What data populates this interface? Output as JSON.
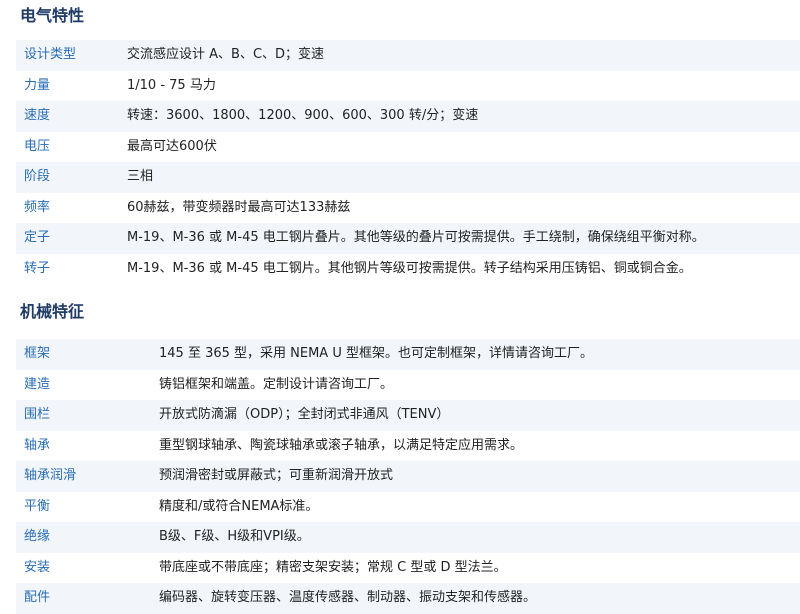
{
  "electrical": {
    "title": "电气特性",
    "rows": [
      {
        "label": "设计类型",
        "value": "交流感应设计 A、B、C、D；变速"
      },
      {
        "label": "力量",
        "value": "1/10 - 75 马力"
      },
      {
        "label": "速度",
        "value": "转速：3600、1800、1200、900、600、300 转/分；变速"
      },
      {
        "label": "电压",
        "value": "最高可达600伏"
      },
      {
        "label": "阶段",
        "value": "三相"
      },
      {
        "label": "频率",
        "value": "60赫兹，带变频器时最高可达133赫兹"
      },
      {
        "label": "定子",
        "value": "M-19、M-36 或 M-45 电工钢片叠片。其他等级的叠片可按需提供。手工绕制，确保绕组平衡对称。"
      },
      {
        "label": "转子",
        "value": "M-19、M-36 或 M-45 电工钢片。其他钢片等级可按需提供。转子结构采用压铸铝、铜或铜合金。"
      }
    ]
  },
  "mechanical": {
    "title": "机械特征",
    "rows": [
      {
        "label": "框架",
        "value": "145 至 365 型，采用 NEMA U 型框架。也可定制框架，详情请咨询工厂。"
      },
      {
        "label": "建造",
        "value": "铸铝框架和端盖。定制设计请咨询工厂。"
      },
      {
        "label": "围栏",
        "value": "开放式防滴漏（ODP）；全封闭式非通风（TENV）"
      },
      {
        "label": "轴承",
        "value": "重型钢球轴承、陶瓷球轴承或滚子轴承，以满足特定应用需求。"
      },
      {
        "label": "轴承润滑",
        "value": "预润滑密封或屏蔽式；可重新润滑开放式"
      },
      {
        "label": "平衡",
        "value": "精度和/或符合NEMA标准。"
      },
      {
        "label": "绝缘",
        "value": "B级、F级、H级和VPI级。"
      },
      {
        "label": "安装",
        "value": "带底座或不带底座；精密支架安装；常规 C 型或 D 型法兰。"
      },
      {
        "label": "配件",
        "value": "编码器、旋转变压器、温度传感器、制动器、振动支架和传感器。"
      }
    ]
  }
}
